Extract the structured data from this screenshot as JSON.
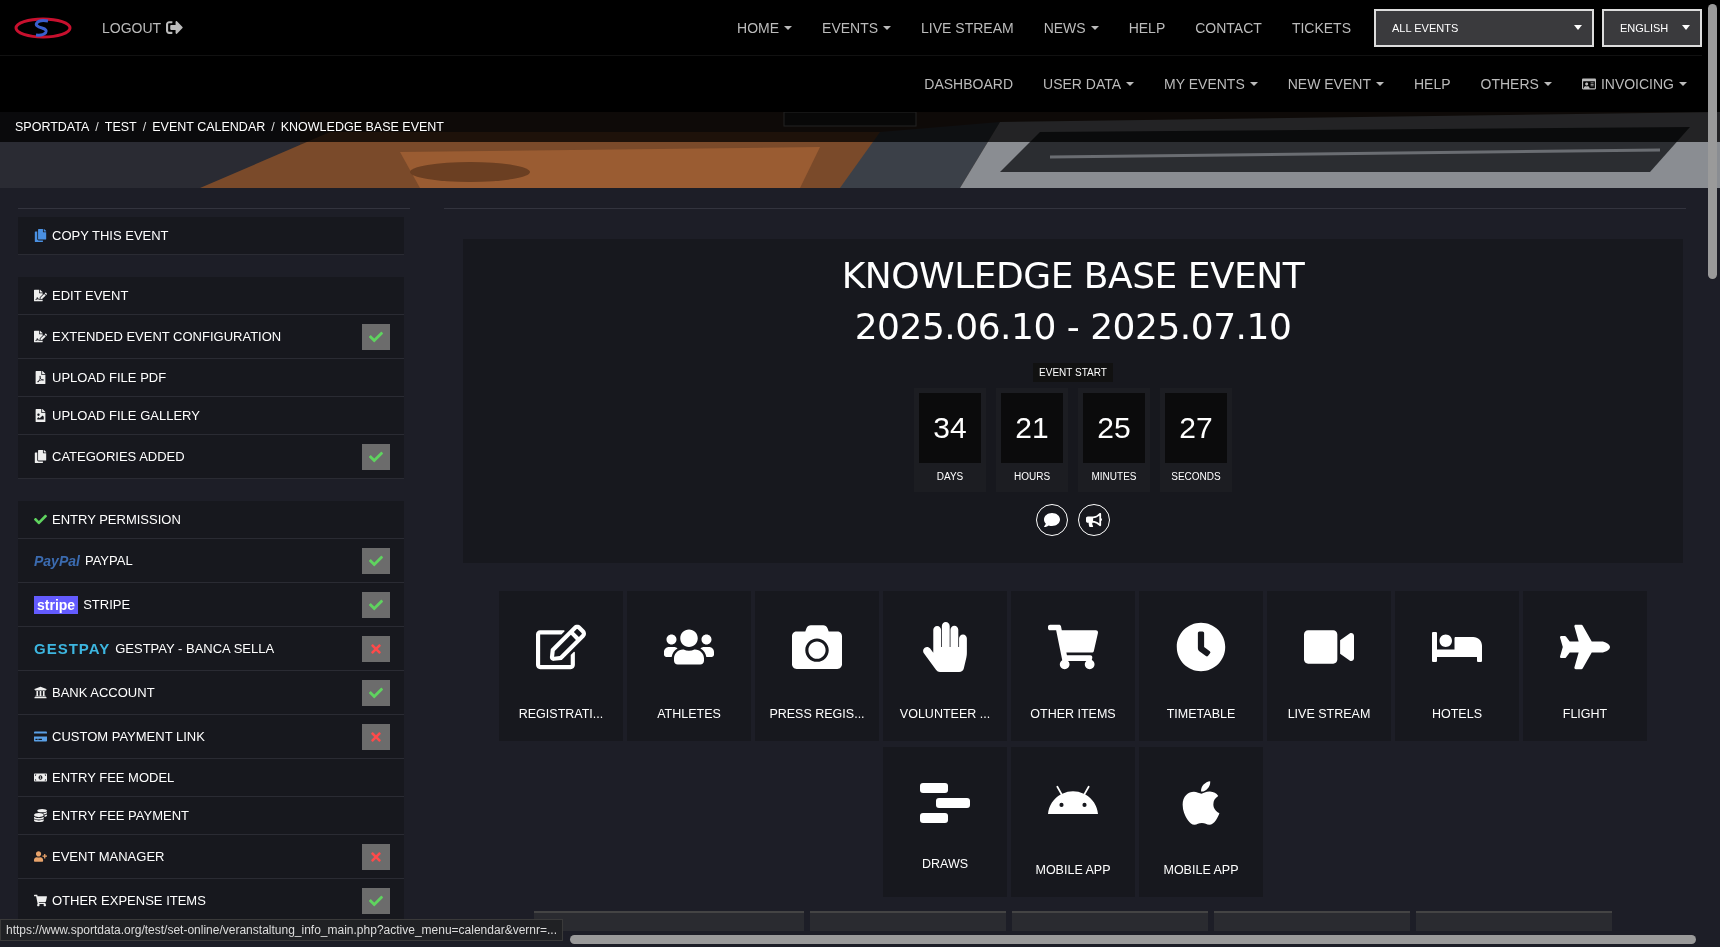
{
  "header": {
    "logout": "LOGOUT",
    "nav_primary": [
      {
        "label": "HOME",
        "dropdown": true
      },
      {
        "label": "EVENTS",
        "dropdown": true
      },
      {
        "label": "LIVE STREAM",
        "dropdown": false
      },
      {
        "label": "NEWS",
        "dropdown": true
      },
      {
        "label": "HELP",
        "dropdown": false
      },
      {
        "label": "CONTACT",
        "dropdown": false
      },
      {
        "label": "TICKETS",
        "dropdown": false
      }
    ],
    "event_select": {
      "value": "ALL EVENTS"
    },
    "language_select": {
      "value": "ENGLISH"
    },
    "nav_secondary": [
      {
        "label": "DASHBOARD",
        "dropdown": false
      },
      {
        "label": "USER DATA",
        "dropdown": true
      },
      {
        "label": "MY EVENTS",
        "dropdown": true
      },
      {
        "label": "NEW EVENT",
        "dropdown": true
      },
      {
        "label": "HELP",
        "dropdown": false
      },
      {
        "label": "OTHERS",
        "dropdown": true
      },
      {
        "label": "INVOICING",
        "dropdown": true
      }
    ]
  },
  "breadcrumb": {
    "separator": "/",
    "items": [
      "SPORTDATA",
      "TEST",
      "EVENT CALENDAR",
      "KNOWLEDGE BASE EVENT"
    ]
  },
  "sidebar": {
    "groups": [
      {
        "items": [
          {
            "label": "COPY THIS EVENT",
            "kind": "link"
          }
        ]
      },
      {
        "items": [
          {
            "label": "EDIT EVENT",
            "kind": "link"
          },
          {
            "label": "EXTENDED EVENT CONFIGURATION",
            "kind": "status",
            "complete": true
          },
          {
            "label": "UPLOAD FILE PDF",
            "kind": "link"
          },
          {
            "label": "UPLOAD FILE GALLERY",
            "kind": "link"
          },
          {
            "label": "CATEGORIES ADDED",
            "kind": "status",
            "complete": true
          }
        ]
      },
      {
        "items": [
          {
            "label": "ENTRY PERMISSION",
            "kind": "link"
          },
          {
            "label": "PAYPAL",
            "logo": "PayPal",
            "kind": "status",
            "complete": true
          },
          {
            "label": "STRIPE",
            "logo": "stripe",
            "kind": "status",
            "complete": true
          },
          {
            "label": "GESTPAY - BANCA SELLA",
            "logo": "GESTPAY",
            "kind": "status",
            "complete": false
          },
          {
            "label": "BANK ACCOUNT",
            "kind": "status",
            "complete": true
          },
          {
            "label": "CUSTOM PAYMENT LINK",
            "kind": "status",
            "complete": false
          },
          {
            "label": "ENTRY FEE MODEL",
            "kind": "link"
          },
          {
            "label": "ENTRY FEE PAYMENT",
            "kind": "link"
          },
          {
            "label": "EVENT MANAGER",
            "kind": "status",
            "complete": false
          },
          {
            "label": "OTHER EXPENSE ITEMS",
            "kind": "status",
            "complete": true
          }
        ]
      }
    ]
  },
  "event": {
    "title": "KNOWLEDGE BASE EVENT",
    "dates": "2025.06.10 - 2025.07.10",
    "countdown_label": "EVENT START",
    "countdown": [
      {
        "value": "34",
        "unit": "DAYS"
      },
      {
        "value": "21",
        "unit": "HOURS"
      },
      {
        "value": "25",
        "unit": "MINUTES"
      },
      {
        "value": "27",
        "unit": "SECONDS"
      }
    ]
  },
  "tiles": [
    [
      "REGISTRATI...",
      "ATHLETES",
      "PRESS REGIS...",
      "VOLUNTEER ...",
      "OTHER ITEMS",
      "TIMETABLE",
      "LIVE STREAM",
      "HOTELS",
      "FLIGHT"
    ],
    [
      "DRAWS",
      "MOBILE APP",
      "MOBILE APP"
    ]
  ],
  "status_url": "https://www.sportdata.org/test/set-online/veranstaltung_info_main.php?active_menu=calendar&vernr=..."
}
